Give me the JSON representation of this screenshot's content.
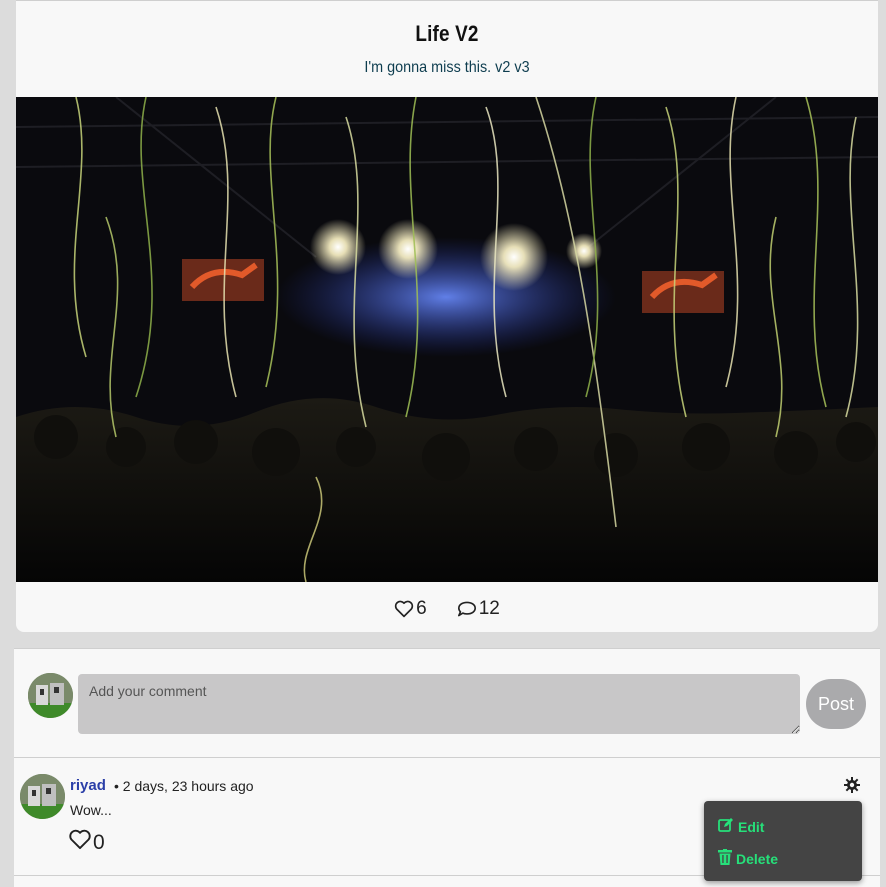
{
  "post": {
    "title": "Life V2",
    "subtitle": "I'm gonna miss this. v2 v3",
    "likes": "6",
    "comments": "12"
  },
  "comment_form": {
    "placeholder": "Add your comment",
    "post_label": "Post"
  },
  "comments": [
    {
      "author": "riyad",
      "time": "• 2 days, 23 hours ago",
      "text": "Wow...",
      "likes": "0",
      "menu": {
        "edit_label": "Edit",
        "delete_label": "Delete"
      }
    }
  ],
  "colors": {
    "author_link": "#2b3fa8",
    "menu_accent": "#26e07a",
    "menu_bg": "#444444",
    "input_bg": "#c8c7c8"
  },
  "icons": [
    "heart-icon",
    "comment-bubble-icon",
    "gear-icon",
    "edit-icon",
    "trash-icon"
  ]
}
